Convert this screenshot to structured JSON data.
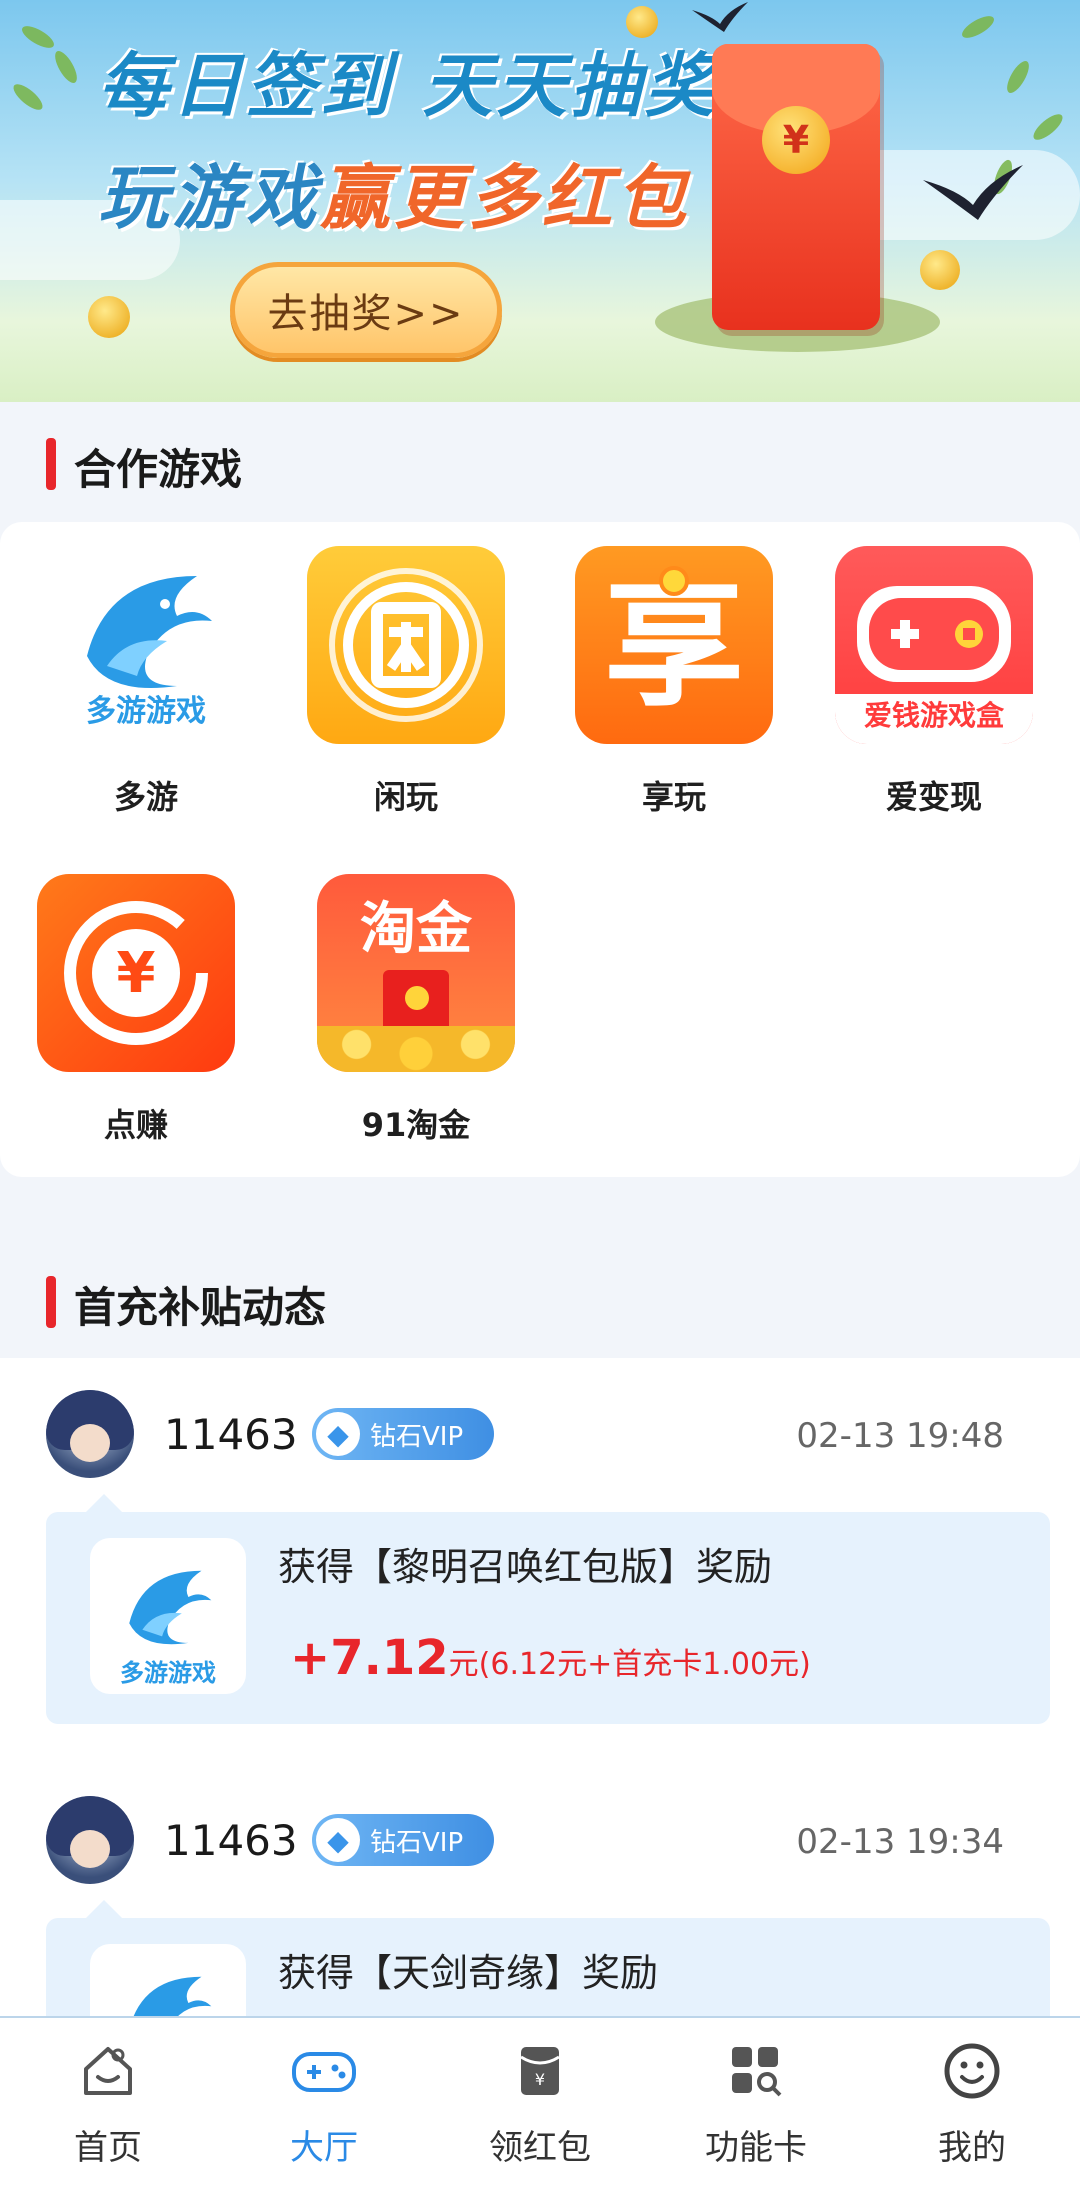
{
  "banner": {
    "line1": "每日签到 天天抽奖",
    "line2_a": "玩游戏",
    "line2_b": "赢更多红包",
    "button": "去抽奖>>",
    "coin_symbol": "¥"
  },
  "partner_section": {
    "title": "合作游戏",
    "games": [
      {
        "name": "多游",
        "icon": "duoyou-dolphin-icon",
        "icon_text": "多游游戏"
      },
      {
        "name": "闲玩",
        "icon": "xianwan-icon"
      },
      {
        "name": "享玩",
        "icon": "xiangwan-icon",
        "icon_text": "享"
      },
      {
        "name": "爱变现",
        "icon": "aibianxian-gamepad-icon",
        "icon_text": "爱钱游戏盒"
      },
      {
        "name": "点赚",
        "icon": "dianzhuan-coin-icon",
        "icon_text": "¥"
      },
      {
        "name": "91淘金",
        "icon": "taojin-icon",
        "icon_text": "淘金"
      }
    ]
  },
  "feed_section": {
    "title": "首充补贴动态",
    "items": [
      {
        "uid": "11463",
        "vip": "钻石VIP",
        "time": "02-13 19:48",
        "reward": "获得【黎明召唤红包版】奖励",
        "amount_big": "+7.12",
        "amount_detail": "元(6.12元+首充卡1.00元)",
        "game_icon_text": "多游游戏"
      },
      {
        "uid": "11463",
        "vip": "钻石VIP",
        "time": "02-13 19:34",
        "reward": "获得【天剑奇缘】奖励"
      }
    ]
  },
  "bottom_nav": [
    {
      "label": "首页",
      "icon": "home-icon",
      "active": false
    },
    {
      "label": "大厅",
      "icon": "gamepad-icon",
      "active": true
    },
    {
      "label": "领红包",
      "icon": "red-packet-icon",
      "active": false
    },
    {
      "label": "功能卡",
      "icon": "grid-search-icon",
      "active": false
    },
    {
      "label": "我的",
      "icon": "smiley-icon",
      "active": false
    }
  ],
  "colors": {
    "accent": "#2a8ae6",
    "red": "#e8262b",
    "bubble": "#e6f2fd"
  }
}
